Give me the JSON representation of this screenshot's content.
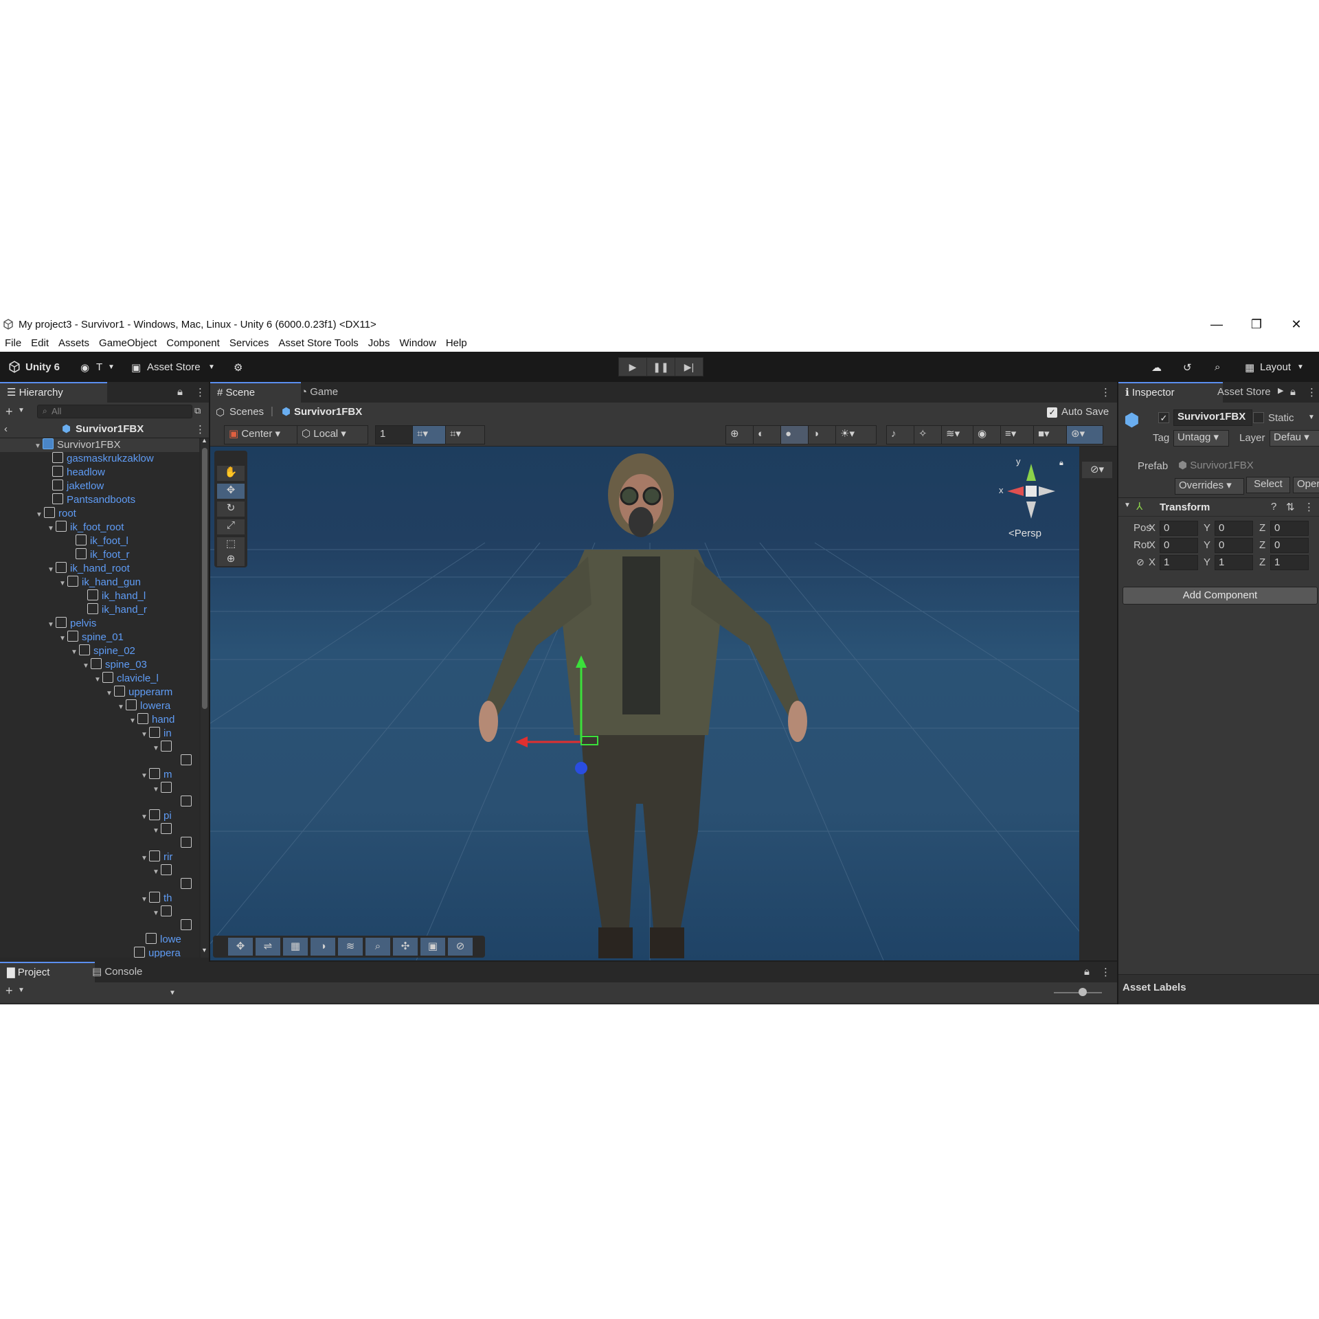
{
  "window": {
    "title": "My project3 - Survivor1 - Windows, Mac, Linux - Unity 6 (6000.0.23f1) <DX11>",
    "controls": [
      "—",
      "❐",
      "✕"
    ]
  },
  "menu": [
    "File",
    "Edit",
    "Assets",
    "GameObject",
    "Component",
    "Services",
    "Asset Store Tools",
    "Jobs",
    "Window",
    "Help"
  ],
  "toolbar": {
    "unity_label": "Unity 6",
    "account_label": "T",
    "asset_store_label": "Asset Store",
    "layout_label": "Layout"
  },
  "hierarchy": {
    "tab": "Hierarchy",
    "search_placeholder": "All",
    "scene_header": "Survivor1FBX",
    "items": [
      {
        "label": "Survivor1FBX",
        "depth": 0,
        "expanded": true
      },
      {
        "label": "gasmaskrukzaklow",
        "depth": 1
      },
      {
        "label": "headlow",
        "depth": 1
      },
      {
        "label": "jaketlow",
        "depth": 1
      },
      {
        "label": "Pantsandboots",
        "depth": 1
      },
      {
        "label": "root",
        "depth": 1,
        "expanded": true
      },
      {
        "label": "ik_foot_root",
        "depth": 2,
        "expanded": true
      },
      {
        "label": "ik_foot_l",
        "depth": 3
      },
      {
        "label": "ik_foot_r",
        "depth": 3
      },
      {
        "label": "ik_hand_root",
        "depth": 2,
        "expanded": true
      },
      {
        "label": "ik_hand_gun",
        "depth": 3,
        "expanded": true
      },
      {
        "label": "ik_hand_l",
        "depth": 4
      },
      {
        "label": "ik_hand_r",
        "depth": 4
      },
      {
        "label": "pelvis",
        "depth": 2,
        "expanded": true
      },
      {
        "label": "spine_01",
        "depth": 3,
        "expanded": true
      },
      {
        "label": "spine_02",
        "depth": 4,
        "expanded": true
      },
      {
        "label": "spine_03",
        "depth": 5,
        "expanded": true
      },
      {
        "label": "clavicle_l",
        "depth": 6,
        "expanded": true
      },
      {
        "label": "upperarm",
        "depth": 7,
        "expanded": true
      },
      {
        "label": "lowera",
        "depth": 8,
        "expanded": true
      },
      {
        "label": "hand",
        "depth": 9,
        "expanded": true
      },
      {
        "label": "in",
        "depth": 10,
        "expanded": true
      },
      {
        "label": "",
        "depth": 11,
        "expanded": true
      },
      {
        "label": "",
        "depth": 12
      },
      {
        "label": "m",
        "depth": 10,
        "expanded": true
      },
      {
        "label": "",
        "depth": 11,
        "expanded": true
      },
      {
        "label": "",
        "depth": 12
      },
      {
        "label": "pi",
        "depth": 10,
        "expanded": true
      },
      {
        "label": "",
        "depth": 11,
        "expanded": true
      },
      {
        "label": "",
        "depth": 12
      },
      {
        "label": "rir",
        "depth": 10,
        "expanded": true
      },
      {
        "label": "",
        "depth": 11,
        "expanded": true
      },
      {
        "label": "",
        "depth": 12
      },
      {
        "label": "th",
        "depth": 10,
        "expanded": true
      },
      {
        "label": "",
        "depth": 11,
        "expanded": true
      },
      {
        "label": "",
        "depth": 12
      },
      {
        "label": "lowe",
        "depth": 9
      },
      {
        "label": "uppera",
        "depth": 8
      }
    ]
  },
  "scene": {
    "tabs": [
      "Scene",
      "Game"
    ],
    "breadcrumb_root": "Scenes",
    "breadcrumb_obj": "Survivor1FBX",
    "auto_save": "Auto Save",
    "pivot": "Center",
    "space": "Local",
    "grid_size": "1",
    "persp": "Persp",
    "gizmo_y": "y",
    "gizmo_x": "x"
  },
  "inspector": {
    "tab": "Inspector",
    "tab2": "Asset Store",
    "object_name": "Survivor1FBX",
    "static": "Static",
    "tag_label": "Tag",
    "tag_value": "Untagg",
    "layer_label": "Layer",
    "layer_value": "Defau",
    "prefab_label": "Prefab",
    "prefab_value": "Survivor1FBX",
    "overrides": "Overrides",
    "select": "Select",
    "open": "Oper",
    "transform_title": "Transform",
    "rows": [
      {
        "label": "Pos",
        "x": "0",
        "y": "0",
        "z": "0"
      },
      {
        "label": "Rot",
        "x": "0",
        "y": "0",
        "z": "0"
      },
      {
        "label": "",
        "x": "1",
        "y": "1",
        "z": "1"
      }
    ],
    "axis_x": "X",
    "axis_y": "Y",
    "axis_z": "Z",
    "add_component": "Add Component",
    "asset_labels": "Asset Labels"
  },
  "bottom": {
    "tabs": [
      "Project",
      "Console"
    ]
  }
}
